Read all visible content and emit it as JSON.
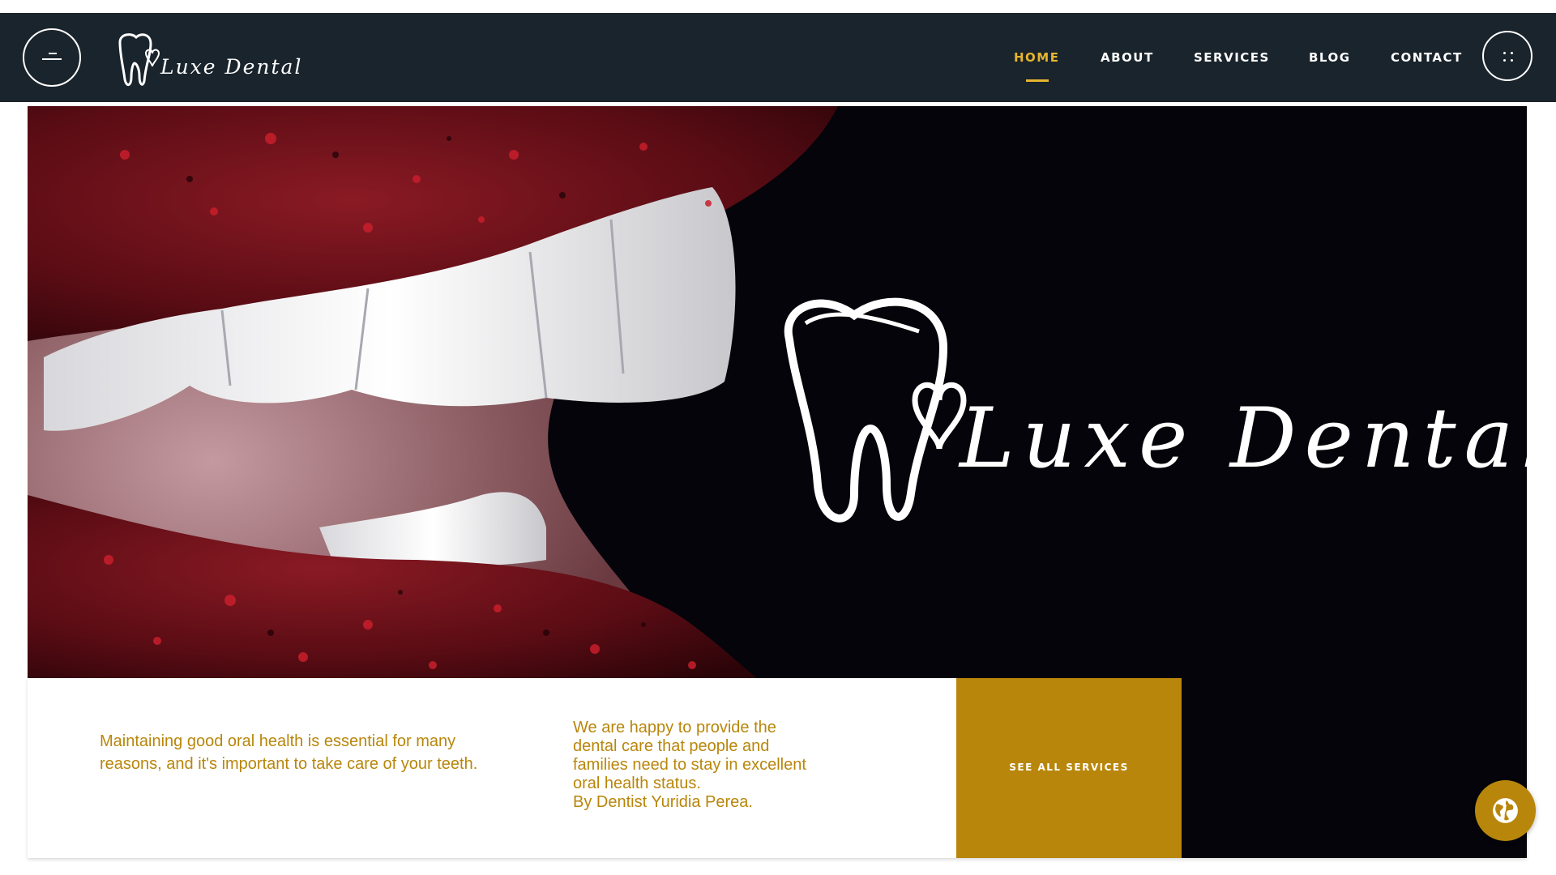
{
  "header": {
    "brand_name": "Luxe Dental",
    "menu_icon": "menu-icon",
    "nav": [
      {
        "label": "HOME",
        "active": true
      },
      {
        "label": "ABOUT",
        "active": false
      },
      {
        "label": "SERVICES",
        "active": false
      },
      {
        "label": "BLOG",
        "active": false
      },
      {
        "label": "CONTACT",
        "active": false
      }
    ],
    "grid_icon": "dots-grid-icon"
  },
  "hero": {
    "brand_name": "Luxe Dental",
    "image": "smile-with-red-glitter-lips"
  },
  "band": {
    "text_left": "Maintaining good oral health is essential for many reasons, and it's important to take care of your teeth.",
    "text_right_lines": [
      "We are happy to provide the",
      "dental care that people and",
      "families need to stay in excellent",
      "oral health status.",
      "By Dentist Yuridia Perea."
    ],
    "cta_label": "SEE ALL SERVICES"
  },
  "floating": {
    "icon": "globe-icon"
  },
  "colors": {
    "header_bg": "#1a242c",
    "accent_gold": "#b8860b",
    "nav_active": "#e5b52f",
    "hero_bg": "#04040a"
  }
}
